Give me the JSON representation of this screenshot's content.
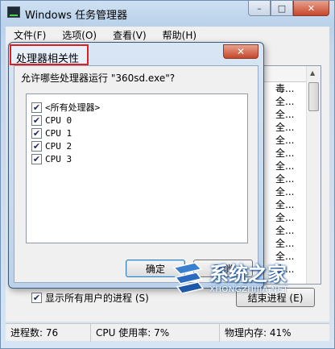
{
  "main_window": {
    "title": "Windows 任务管理器",
    "controls": {
      "minimize": "–",
      "maximize": "□",
      "close": "✕"
    },
    "menu": [
      "文件(F)",
      "选项(O)",
      "查看(V)",
      "帮助(H)"
    ],
    "process_column_partial": [
      "毒...",
      "全...",
      "全...",
      "全...",
      "全...",
      "全...",
      "全...",
      "全...",
      "全...",
      "全...",
      "全...",
      "全...",
      "全...",
      "全...",
      "全..."
    ],
    "show_all_users": {
      "checked": true,
      "label": "显示所有用户的进程 (S)"
    },
    "end_process_button": "结束进程 (E)",
    "status_bar": {
      "processes": "进程数: 76",
      "cpu": "CPU 使用率: 7%",
      "memory": "物理内存: 41%"
    }
  },
  "dialog": {
    "title": "处理器相关性",
    "close": "✕",
    "question": "允许哪些处理器运行 \"360sd.exe\"?",
    "processors": [
      {
        "label": "<所有处理器>",
        "checked": true
      },
      {
        "label": "CPU 0",
        "checked": true
      },
      {
        "label": "CPU 1",
        "checked": true
      },
      {
        "label": "CPU 2",
        "checked": true
      },
      {
        "label": "CPU 3",
        "checked": true
      }
    ],
    "ok_button": "确定",
    "cancel_button": "取消"
  },
  "watermark": {
    "name": "系统之家",
    "url": "XHONGZHIJIA.NET"
  },
  "colors": {
    "title_highlight_border": "#e01e1e",
    "close_button": "#c7462b",
    "window_frame": "#b9d1ea"
  }
}
